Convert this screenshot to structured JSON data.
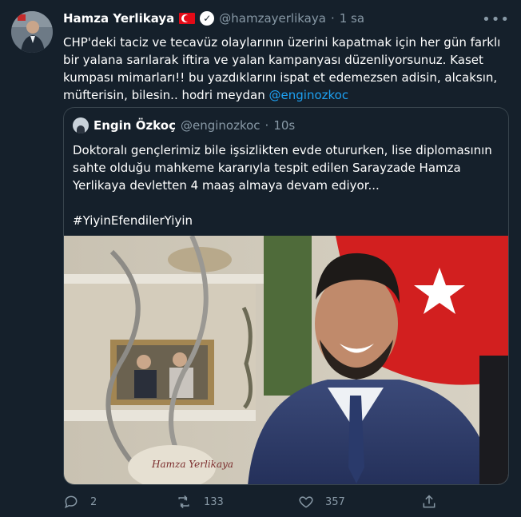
{
  "author": {
    "name": "Hamza Yerlikaya",
    "handle": "@hamzayerlikaya",
    "separator": "·",
    "time": "1 sa",
    "verified_icon": "check-badge-icon",
    "flag_icon": "turkey-flag-icon"
  },
  "tweet": {
    "text": "CHP'deki taciz ve tecavüz olaylarının üzerini kapatmak için her gün farklı bir yalana sarılarak iftira ve yalan kampanyası düzenliyorsunuz. Kaset kumpası mimarları!! bu yazdıklarını ispat et edemezsen adisin, alcaksın, müfterisin, bilesin.. hodri meydan",
    "mention": "@enginozkoc"
  },
  "quoted": {
    "name": "Engin Özkoç",
    "handle": "@enginozkoc",
    "separator": "·",
    "time": "10s",
    "text": "Doktoralı gençlerimiz bile işsizlikten evde otururken, lise diplomasının sahte olduğu mahkeme kararıyla tespit edilen Sarayzade Hamza Yerlikaya devletten 4 maaş almaya devam ediyor...",
    "hashtag": "#YiyinEfendilerYiyin",
    "photo_caption_text": "Hamza Yerlikaya"
  },
  "actions": {
    "replies": "2",
    "retweets": "133",
    "likes": "357"
  },
  "colors": {
    "background": "#15202b",
    "accent": "#1da1f2",
    "secondary_text": "#8899a6",
    "border": "#38444d"
  }
}
